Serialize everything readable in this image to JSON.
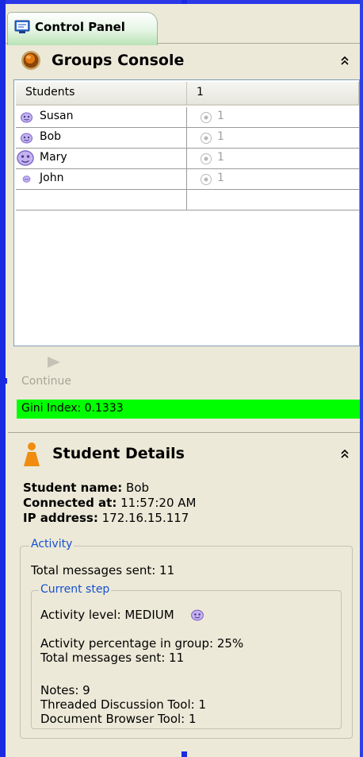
{
  "tab": {
    "label": "Control Panel"
  },
  "groups_console": {
    "title": "Groups Console",
    "columns": [
      "Students",
      "1"
    ],
    "rows": [
      {
        "name": "Susan",
        "value": "1"
      },
      {
        "name": "Bob",
        "value": "1"
      },
      {
        "name": "Mary",
        "value": "1"
      },
      {
        "name": "John",
        "value": "1"
      }
    ],
    "continue_label": "Continue",
    "gini": "Gini Index: 0.1333",
    "gini_color": "#00ff00"
  },
  "student_details": {
    "title": "Student Details",
    "name_label": "Student name:",
    "name_value": "Bob",
    "connected_label": "Connected at:",
    "connected_value": "11:57:20 AM",
    "ip_label": "IP address:",
    "ip_value": "172.16.15.117",
    "activity": {
      "legend": "Activity",
      "total_messages": "Total messages sent: 11",
      "current_step": {
        "legend": "Current step",
        "activity_level": "Activity level: MEDIUM",
        "percentage": "Activity percentage in group: 25%",
        "total_messages": "Total messages sent: 11",
        "notes": "Notes: 9",
        "threaded": "Threaded Discussion Tool: 1",
        "browser": "Document Browser Tool: 1"
      }
    }
  },
  "colors": {
    "frame_blue": "#1a2ae0",
    "legend_blue": "#1550d0",
    "panel_bg": "#ece9d8"
  }
}
